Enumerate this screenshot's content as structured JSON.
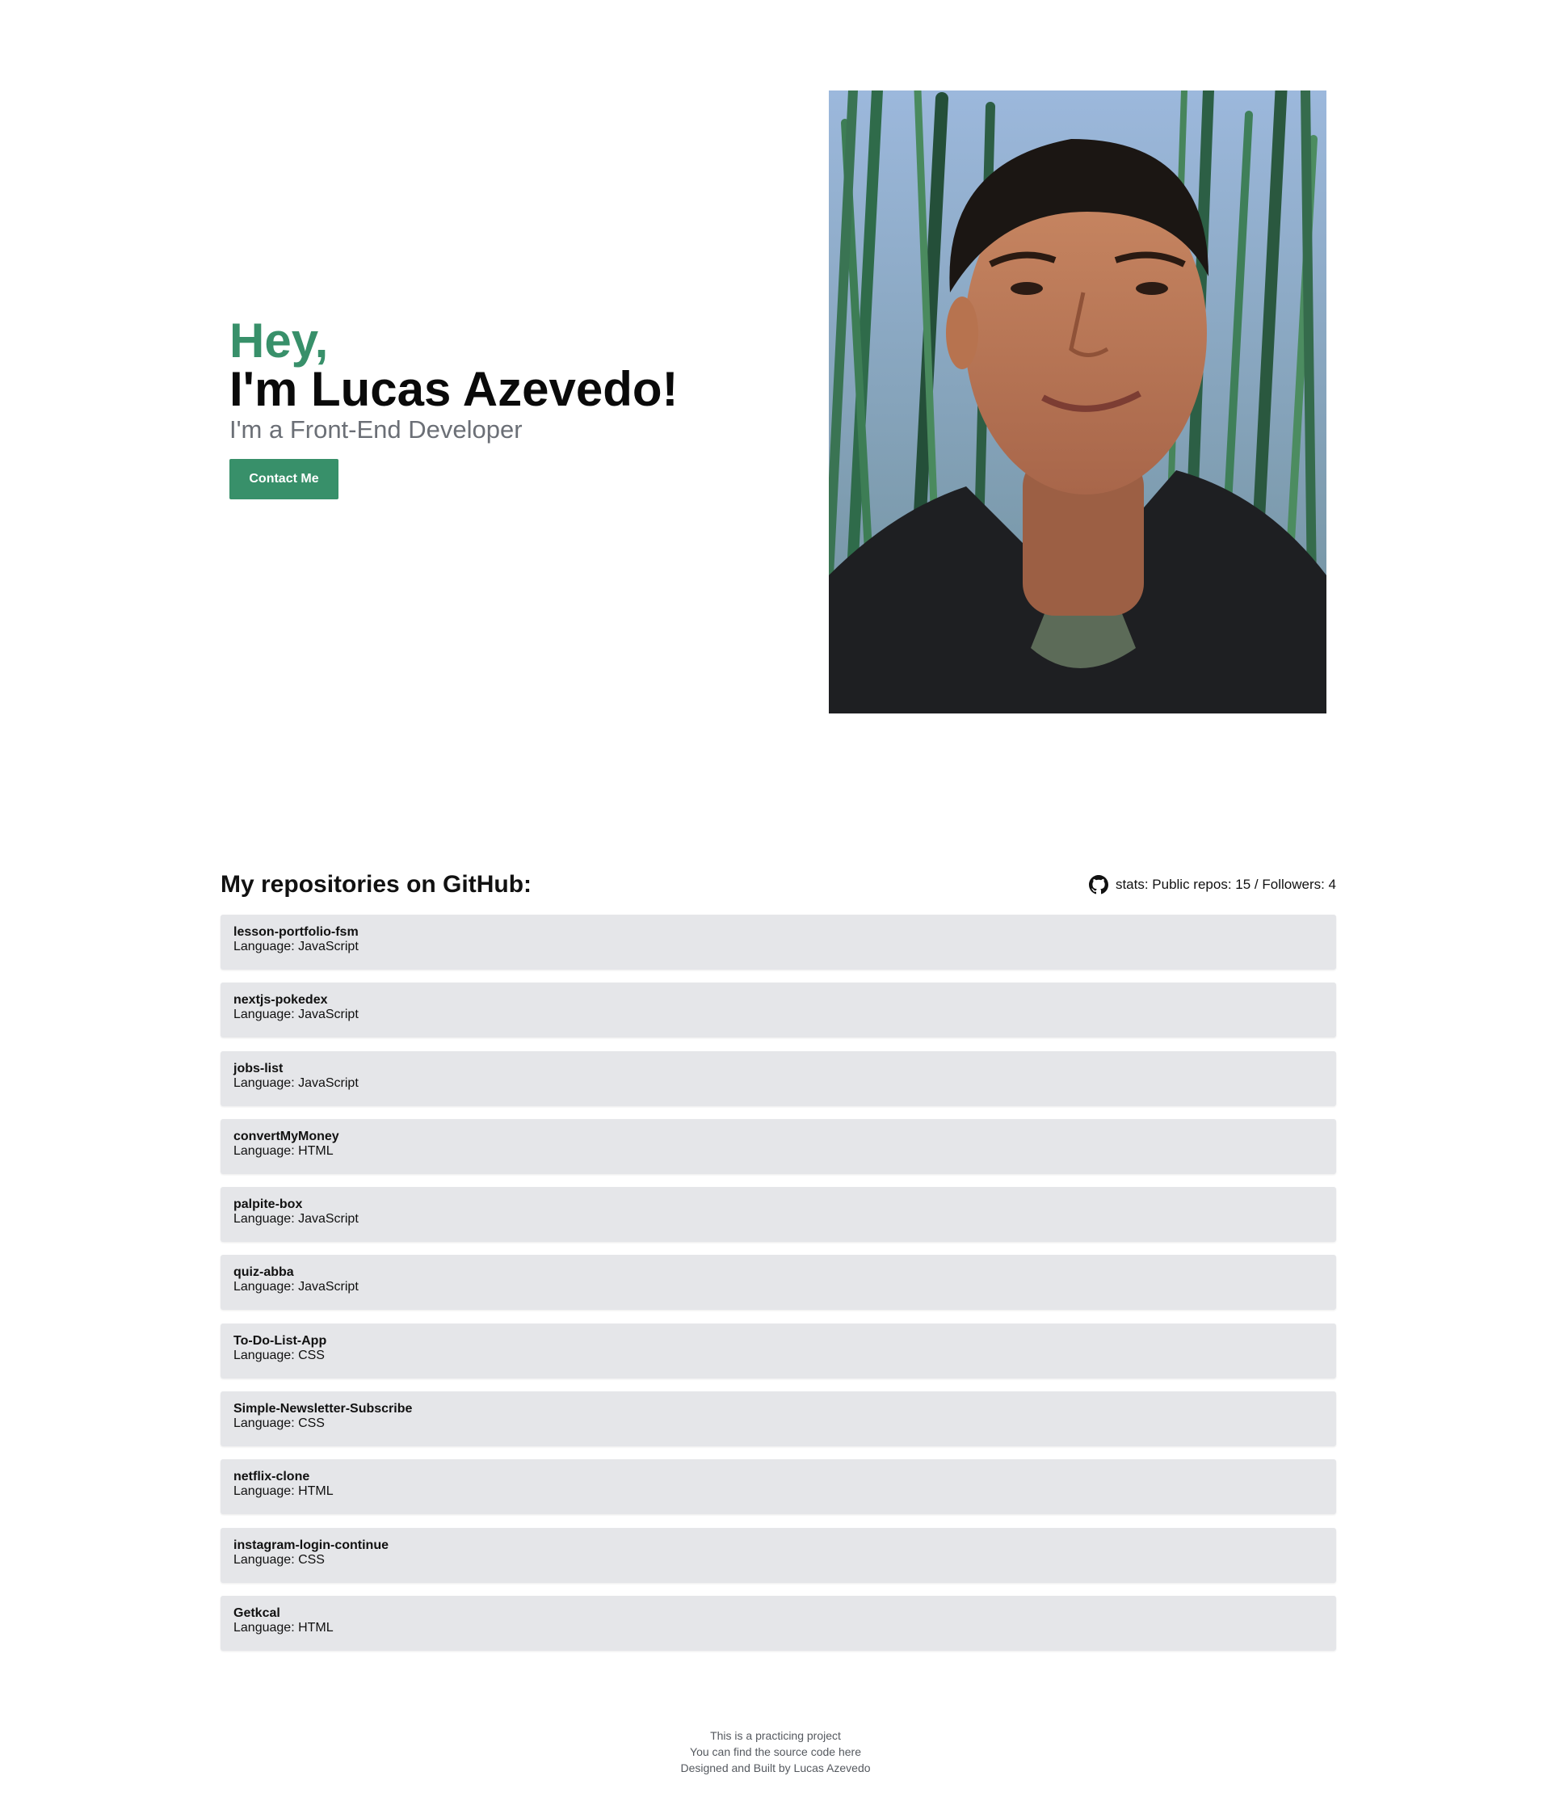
{
  "hero": {
    "greeting": "Hey,",
    "name": "I'm Lucas Azevedo!",
    "role": "I'm a Front-End Developer",
    "contact_label": "Contact Me"
  },
  "repos": {
    "title": "My repositories on GitHub:",
    "stats": "stats: Public repos: 15 / Followers: 4",
    "items": [
      {
        "name": "lesson-portfolio-fsm",
        "language": "Language: JavaScript"
      },
      {
        "name": "nextjs-pokedex",
        "language": "Language: JavaScript"
      },
      {
        "name": "jobs-list",
        "language": "Language: JavaScript"
      },
      {
        "name": "convertMyMoney",
        "language": "Language: HTML"
      },
      {
        "name": "palpite-box",
        "language": "Language: JavaScript"
      },
      {
        "name": "quiz-abba",
        "language": "Language: JavaScript"
      },
      {
        "name": "To-Do-List-App",
        "language": "Language: CSS"
      },
      {
        "name": "Simple-Newsletter-Subscribe",
        "language": "Language: CSS"
      },
      {
        "name": "netflix-clone",
        "language": "Language: HTML"
      },
      {
        "name": "instagram-login-continue",
        "language": "Language: CSS"
      },
      {
        "name": "Getkcal",
        "language": "Language: HTML"
      }
    ]
  },
  "footer": {
    "line1": "This is a practicing project",
    "line2": "You can find the source code here",
    "line3": "Designed and Built by Lucas Azevedo"
  },
  "colors": {
    "accent": "#38906a",
    "card": "#e5e6e9"
  },
  "icons": {
    "github": "github-icon"
  }
}
